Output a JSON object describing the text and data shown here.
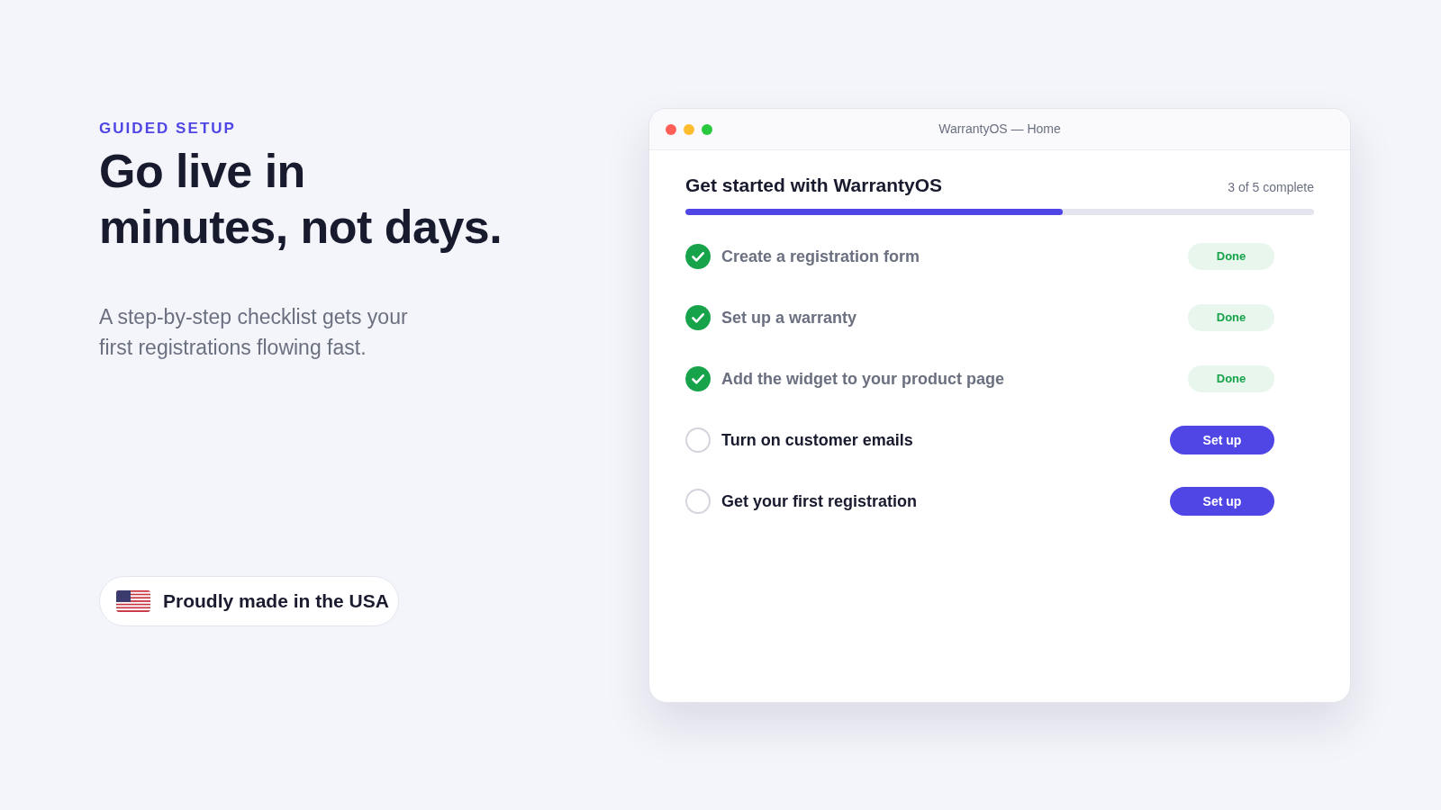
{
  "intro": {
    "eyebrow": "GUIDED SETUP",
    "headline": "Go live in minutes, not days.",
    "description": "A step-by-step checklist gets your first registrations flowing fast."
  },
  "origin_badge": {
    "text": "Proudly made in the USA"
  },
  "window": {
    "title": "WarrantyOS — Home"
  },
  "checklist": {
    "title": "Get started with WarrantyOS",
    "progress_text": "3 of 5 complete",
    "level": 0.6,
    "tasks": [
      {
        "label": "Create a registration form",
        "checked": true,
        "action": "Done"
      },
      {
        "label": "Set up a warranty",
        "checked": true,
        "action": "Done"
      },
      {
        "label": "Add the widget to your product page",
        "checked": true,
        "action": "Done"
      },
      {
        "label": "Turn on customer emails",
        "checked": false,
        "action": "Set up"
      },
      {
        "label": "Get your first registration",
        "checked": false,
        "action": "Set up"
      }
    ]
  }
}
